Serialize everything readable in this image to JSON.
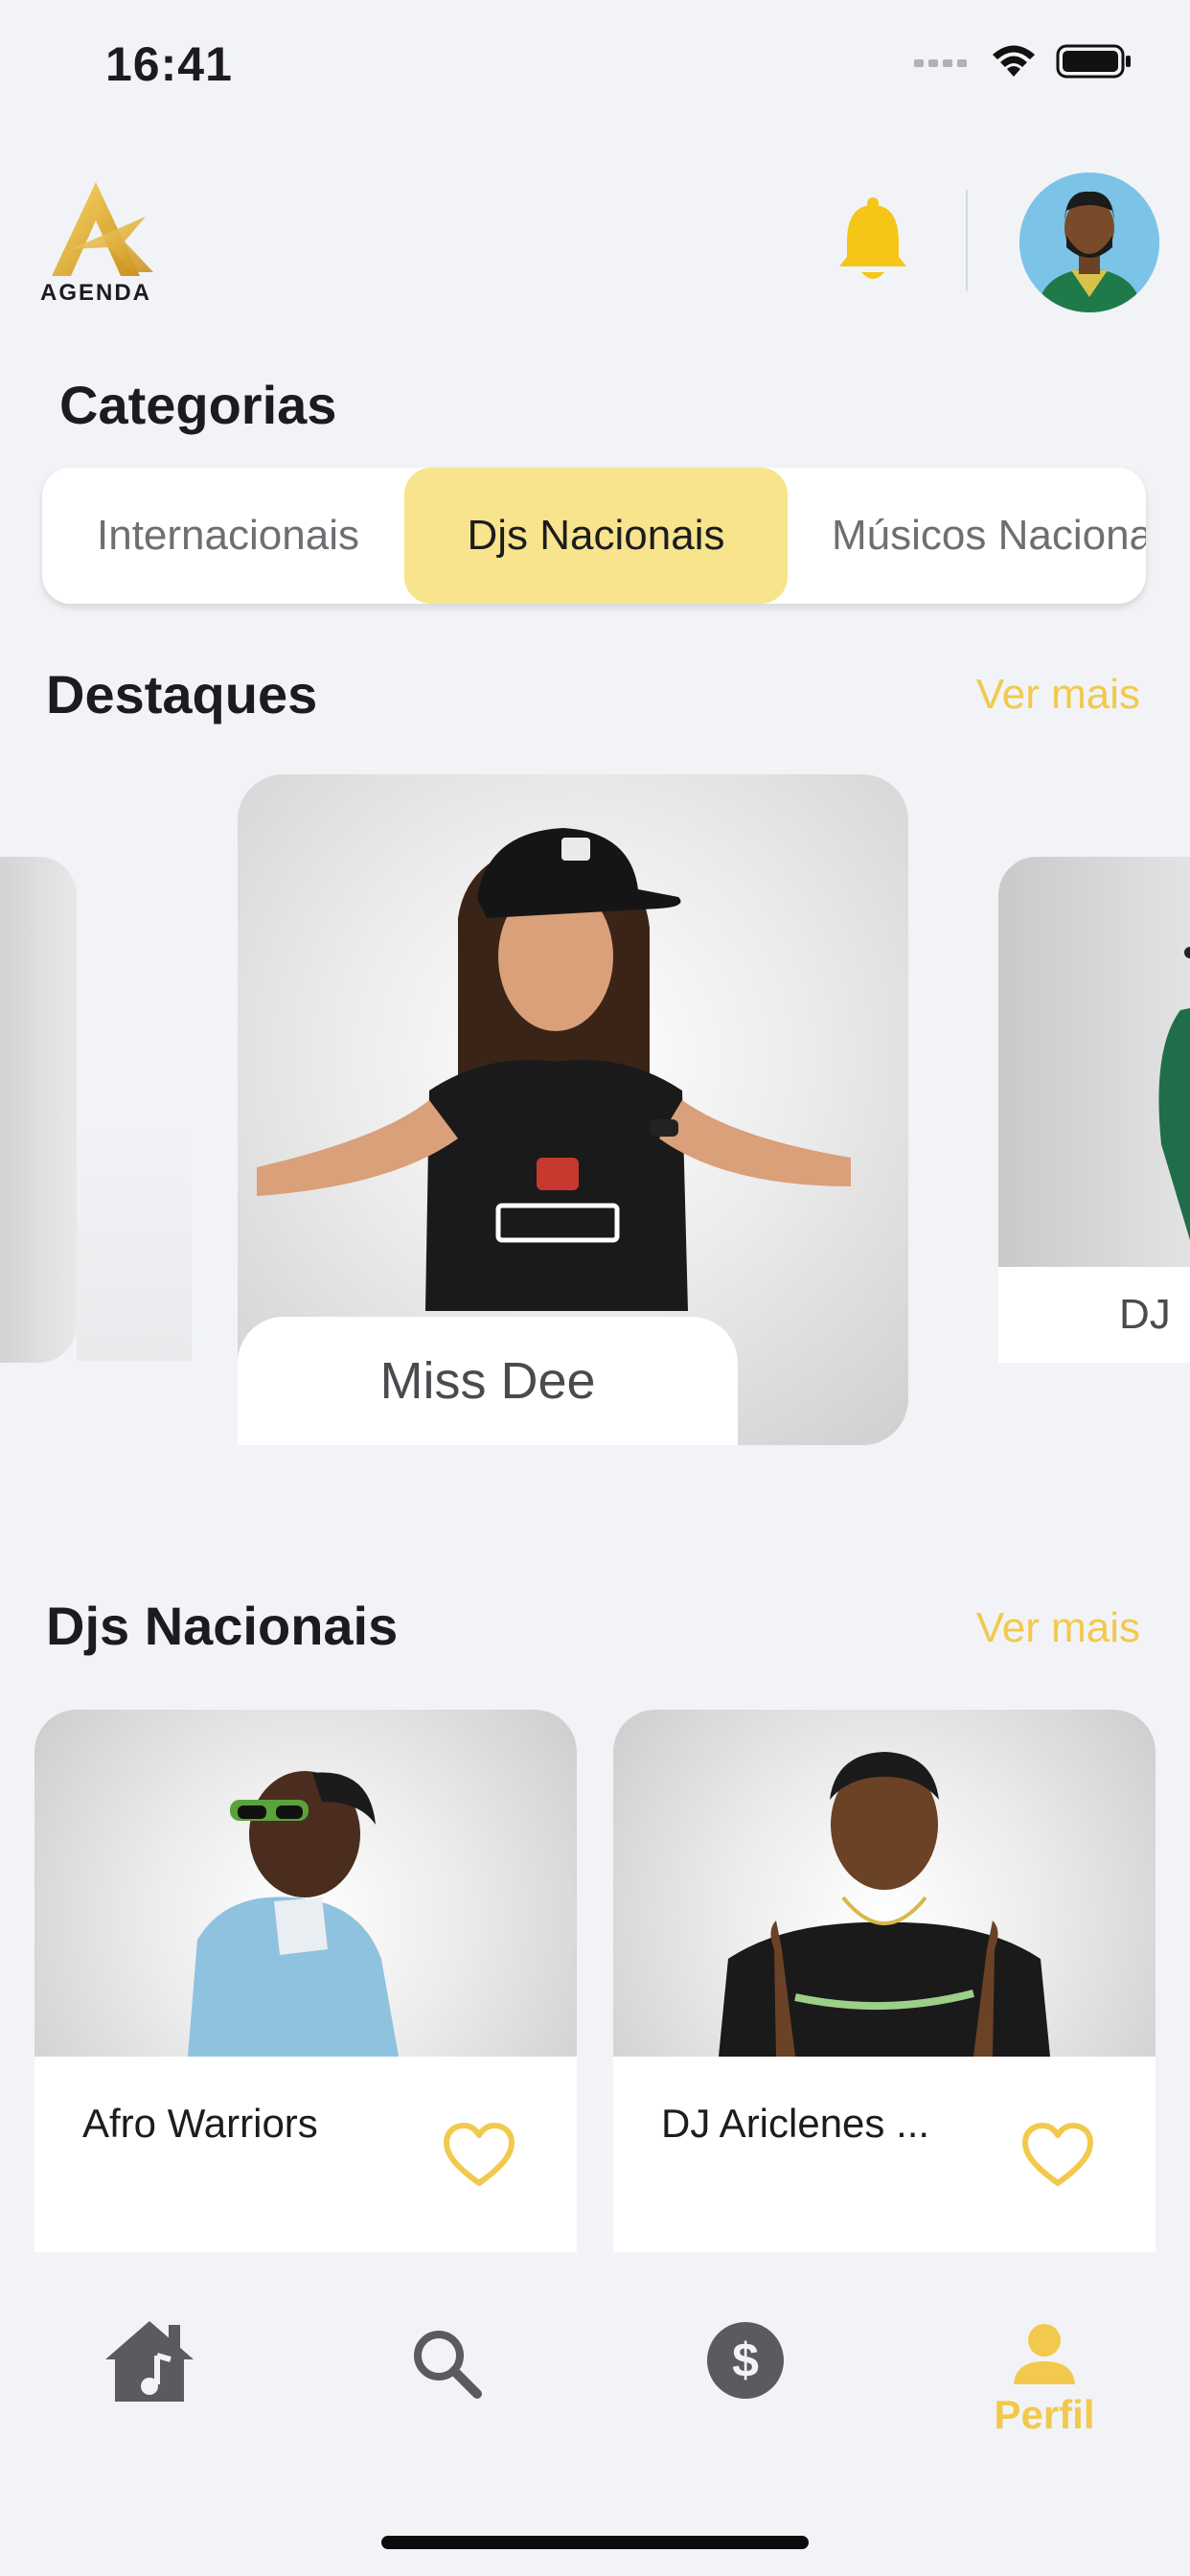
{
  "status_bar": {
    "time": "16:41"
  },
  "header": {
    "logo_text": "AGENDA"
  },
  "categories": {
    "title": "Categorias",
    "items": [
      {
        "label": "Internacionais",
        "active": false
      },
      {
        "label": "Djs Nacionais",
        "active": true
      },
      {
        "label": "Músicos Nacionais",
        "active": false
      }
    ]
  },
  "featured": {
    "title": "Destaques",
    "more_label": "Ver mais",
    "center_card_name": "Miss Dee",
    "right_card_name": "DJ"
  },
  "djs_section": {
    "title": "Djs Nacionais",
    "more_label": "Ver mais",
    "cards": [
      {
        "name": "Afro Warriors"
      },
      {
        "name": "DJ Ariclenes ..."
      }
    ]
  },
  "tabbar": {
    "items": [
      {
        "icon": "home-music-icon"
      },
      {
        "icon": "search-icon"
      },
      {
        "icon": "dollar-icon"
      },
      {
        "icon": "person-icon",
        "label": "Perfil"
      }
    ]
  },
  "colors": {
    "accent": "#f2c94c",
    "active_chip": "#f7e48d",
    "background": "#f1f3f6"
  }
}
